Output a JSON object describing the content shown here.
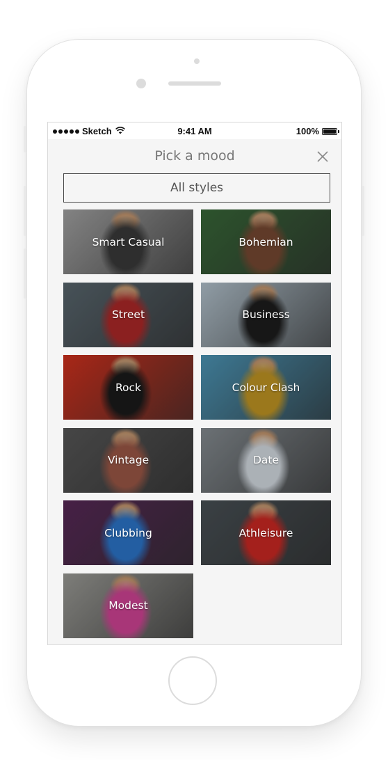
{
  "status_bar": {
    "carrier": "Sketch",
    "time": "9:41 AM",
    "battery": "100%",
    "battery_level": 1.0
  },
  "modal": {
    "title": "Pick a mood",
    "close_icon": "close-icon",
    "all_styles_label": "All styles"
  },
  "moods": [
    {
      "label": "Smart Casual",
      "bg": "#a8a8a8",
      "accent": "#3b3b3b"
    },
    {
      "label": "Bohemian",
      "bg": "#3a6b3a",
      "accent": "#7a4b34"
    },
    {
      "label": "Street",
      "bg": "#5c6a72",
      "accent": "#b22a2a"
    },
    {
      "label": "Business",
      "bg": "#b9c9d4",
      "accent": "#1e1e1e"
    },
    {
      "label": "Rock",
      "bg": "#d8321e",
      "accent": "#1c1c1c"
    },
    {
      "label": "Colour Clash",
      "bg": "#4f9bbd",
      "accent": "#c79a24"
    },
    {
      "label": "Vintage",
      "bg": "#5a5a5a",
      "accent": "#a05a48"
    },
    {
      "label": "Date",
      "bg": "#8a9196",
      "accent": "#dce3ea"
    },
    {
      "label": "Clubbing",
      "bg": "#5b2a5a",
      "accent": "#2d79d0"
    },
    {
      "label": "Athleisure",
      "bg": "#4b5358",
      "accent": "#d22a24"
    },
    {
      "label": "Modest",
      "bg": "#a1a19c",
      "accent": "#d8469a"
    }
  ]
}
